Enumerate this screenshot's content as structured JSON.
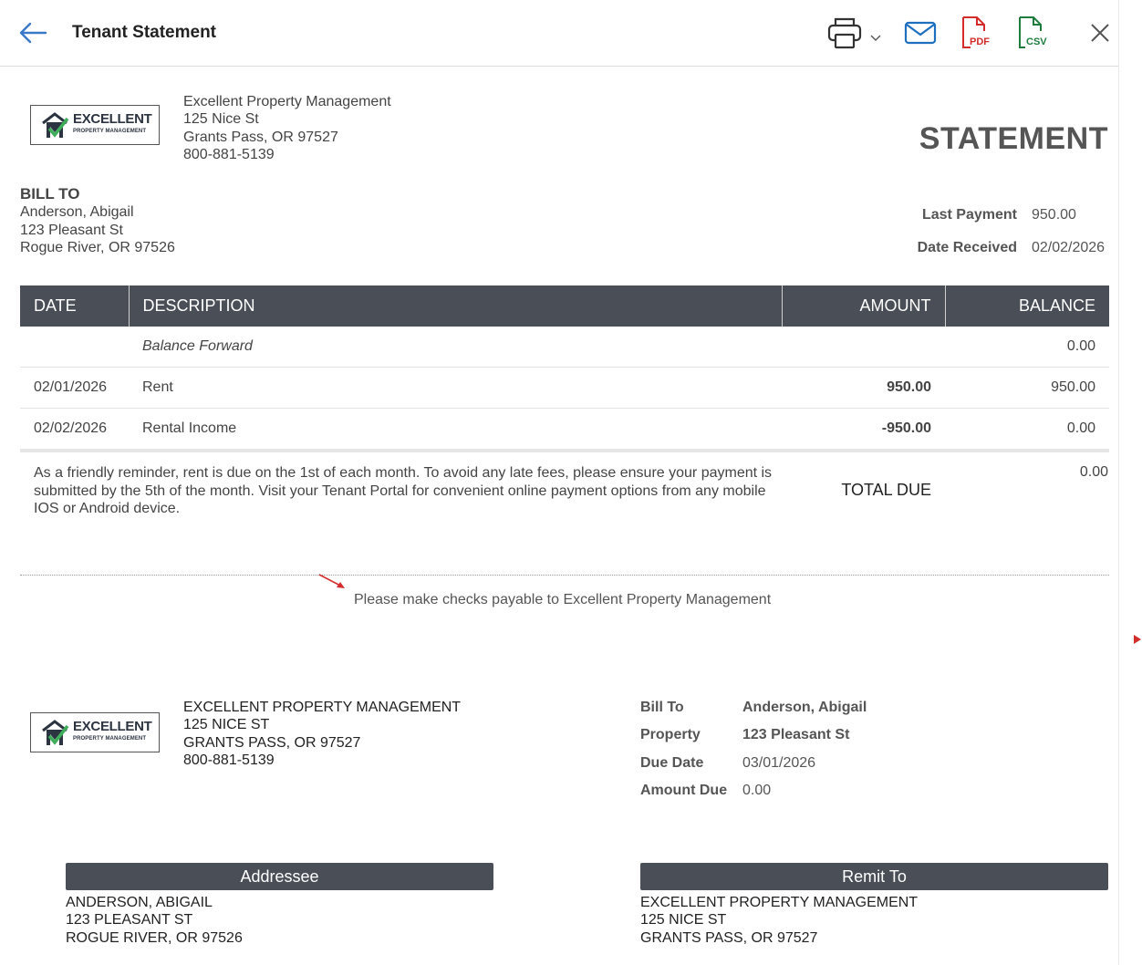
{
  "header": {
    "title": "Tenant Statement",
    "pdf_label": "PDF",
    "csv_label": "CSV"
  },
  "company": {
    "logo_main": "EXCELLENT",
    "logo_sub": "PROPERTY MANAGEMENT",
    "name": "Excellent Property Management",
    "street": "125 Nice St",
    "city": "Grants Pass, OR 97527",
    "phone": "800-881-5139"
  },
  "statement_title": "STATEMENT",
  "bill_to": {
    "heading": "BILL TO",
    "name": "Anderson, Abigail",
    "street": "123 Pleasant St",
    "city": "Rogue River, OR 97526"
  },
  "payment": {
    "last_payment_label": "Last Payment",
    "last_payment_value": "950.00",
    "date_received_label": "Date Received",
    "date_received_value": "02/02/2026"
  },
  "ledger": {
    "columns": [
      "DATE",
      "DESCRIPTION",
      "AMOUNT",
      "BALANCE"
    ],
    "rows": [
      {
        "date": "",
        "description": "Balance Forward",
        "amount": "",
        "balance": "0.00"
      },
      {
        "date": "02/01/2026",
        "description": "Rent",
        "amount": "950.00",
        "balance": "950.00"
      },
      {
        "date": "02/02/2026",
        "description": "Rental Income",
        "amount": "-950.00",
        "balance": "0.00"
      }
    ]
  },
  "reminder": "As a friendly reminder, rent is due on the 1st of each month. To avoid any late fees, please ensure your payment is submitted by the 5th of the month. Visit your Tenant Portal for convenient online payment options from any mobile IOS or Android device.",
  "total": {
    "label": "TOTAL DUE",
    "value": "0.00"
  },
  "checks_note": "Please make checks payable to Excellent Property Management",
  "stub": {
    "company_name": "EXCELLENT PROPERTY MANAGEMENT",
    "company_street": "125 NICE ST",
    "company_city": "GRANTS PASS, OR 97527",
    "company_phone": "800-881-5139",
    "bill_to_label": "Bill To",
    "bill_to_value": "Anderson, Abigail",
    "property_label": "Property",
    "property_value": "123 Pleasant St",
    "due_date_label": "Due Date",
    "due_date_value": "03/01/2026",
    "amount_due_label": "Amount Due",
    "amount_due_value": "0.00"
  },
  "addressee": {
    "heading": "Addressee",
    "name": "ANDERSON, ABIGAIL",
    "street": "123 PLEASANT ST",
    "city": "ROGUE RIVER, OR 97526"
  },
  "remit_to": {
    "heading": "Remit To",
    "name": "EXCELLENT PROPERTY MANAGEMENT",
    "street": "125 NICE ST",
    "city": "GRANTS PASS, OR 97527"
  }
}
